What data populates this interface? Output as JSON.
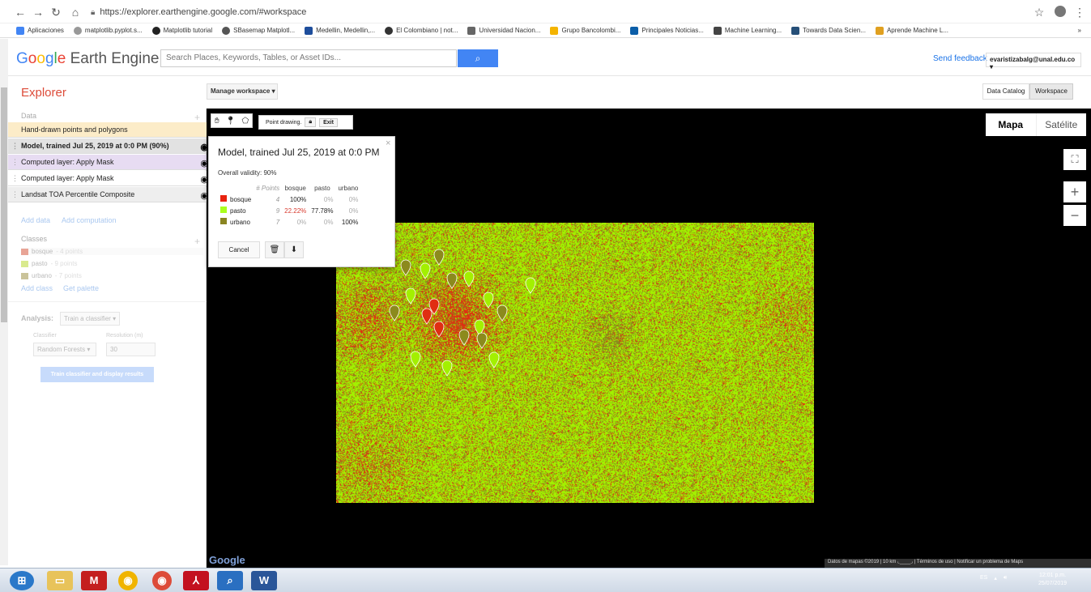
{
  "browser": {
    "url": "https://explorer.earthengine.google.com/#workspace",
    "bookmarks": [
      "Aplicaciones",
      "matplotlib.pyplot.s...",
      "Matplotlib tutorial",
      "SBasemap Matplotl...",
      "Medellin, Medellin,...",
      "El Colombiano | not...",
      "Universidad Nacion...",
      "Grupo Bancolombi...",
      "Principales Noticias...",
      "Machine Learning...",
      "Towards Data Scien...",
      "Aprende Machine L..."
    ],
    "more_bookmarks": "»"
  },
  "header": {
    "logo_google": "Google",
    "logo_rest": "Earth Engine",
    "search_placeholder": "Search Places, Keywords, Tables, or Asset IDs...",
    "feedback": "Send feedback",
    "account": "evaristizabalg@unal.edu.co"
  },
  "subheader": {
    "title": "Explorer",
    "manage_workspace": "Manage workspace",
    "data_catalog": "Data Catalog",
    "workspace": "Workspace"
  },
  "sidebar": {
    "data_label": "Data",
    "layers": [
      {
        "label": "Hand-drawn points and polygons"
      },
      {
        "label": "Model, trained Jul 25, 2019 at 0:0 PM (90%)"
      },
      {
        "label": "Computed layer: Apply Mask"
      },
      {
        "label": "Computed layer: Apply Mask"
      },
      {
        "label": "Landsat TOA Percentile Composite"
      }
    ],
    "add_data": "Add data",
    "add_computation": "Add computation",
    "classes_label": "Classes",
    "classes": [
      {
        "name": "bosque",
        "points": "- 4 points",
        "color": "#e8a496"
      },
      {
        "name": "pasto",
        "points": "- 9 points",
        "color": "#d9ea8e"
      },
      {
        "name": "urbano",
        "points": "- 7 points",
        "color": "#cac39a"
      }
    ],
    "add_class": "Add class",
    "get_palette": "Get palette",
    "analysis_label": "Analysis:",
    "analysis_select": "Train a classifier",
    "classifier_label": "Classifier",
    "classifier_value": "Random Forests",
    "resolution_label": "Resolution (m)",
    "resolution_value": "30",
    "train_button": "Train classifier and display results"
  },
  "map": {
    "point_drawing": "Point drawing.",
    "exit": "Exit",
    "map_type_map": "Mapa",
    "map_type_sat": "Satélite",
    "footer": "Datos de mapas ©2019 | 10 km ⌞____⌟ | Términos de uso | Notificar un problema de Maps",
    "google": "Google"
  },
  "popup": {
    "title": "Model, trained Jul 25, 2019 at 0:0 PM",
    "validity": "Overall validity: 90%",
    "col_points": "# Points",
    "columns": [
      "bosque",
      "pasto",
      "urbano"
    ],
    "rows": [
      {
        "name": "bosque",
        "color": "#e8230f",
        "n": "4",
        "vals": [
          "100%",
          "0%",
          "0%"
        ]
      },
      {
        "name": "pasto",
        "color": "#aaff1d",
        "n": "9",
        "vals": [
          "22.22%",
          "77.78%",
          "0%"
        ]
      },
      {
        "name": "urbano",
        "color": "#8a8521",
        "n": "7",
        "vals": [
          "0%",
          "0%",
          "100%"
        ]
      }
    ],
    "cancel": "Cancel"
  },
  "taskbar": {
    "lang": "ES",
    "time": "12:01 p.m.",
    "date": "25/07/2019"
  },
  "colors": {
    "bosque": "#e02e12",
    "pasto": "#a3f000",
    "urbano": "#8c8a1d"
  }
}
